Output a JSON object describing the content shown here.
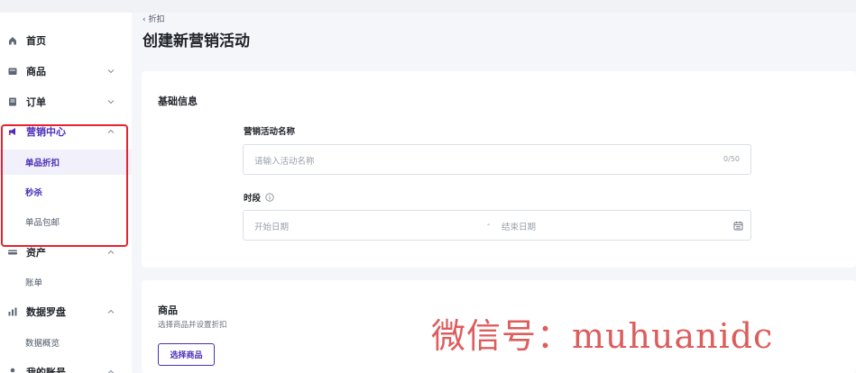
{
  "sidebar": {
    "items": [
      {
        "label": "首页",
        "icon": "home-icon"
      },
      {
        "label": "商品",
        "icon": "product-icon"
      },
      {
        "label": "订单",
        "icon": "order-icon"
      },
      {
        "label": "营销中心",
        "icon": "megaphone-icon"
      },
      {
        "label": "资产",
        "icon": "card-icon"
      },
      {
        "label": "数据罗盘",
        "icon": "bar-chart-icon"
      },
      {
        "label": "我的账号",
        "icon": "user-icon"
      }
    ],
    "marketing_sub": [
      "单品折扣",
      "秒杀",
      "单品包邮"
    ],
    "assets_sub": [
      "账单"
    ],
    "data_sub": [
      "数据概览"
    ]
  },
  "header": {
    "breadcrumb": "‹ 折扣",
    "title": "创建新营销活动"
  },
  "basic_info": {
    "title": "基础信息",
    "name_label": "营销活动名称",
    "name_placeholder": "请输入活动名称",
    "name_counter": "0/50",
    "period_label": "时段",
    "start_placeholder": "开始日期",
    "separator": "-",
    "end_placeholder": "结束日期"
  },
  "products": {
    "title": "商品",
    "description": "选择商品并设置折扣",
    "select_button": "选择商品"
  },
  "watermark": "微信号：muhuanidc",
  "colors": {
    "accent": "#4b2fb8",
    "highlight": "#e5232f"
  }
}
